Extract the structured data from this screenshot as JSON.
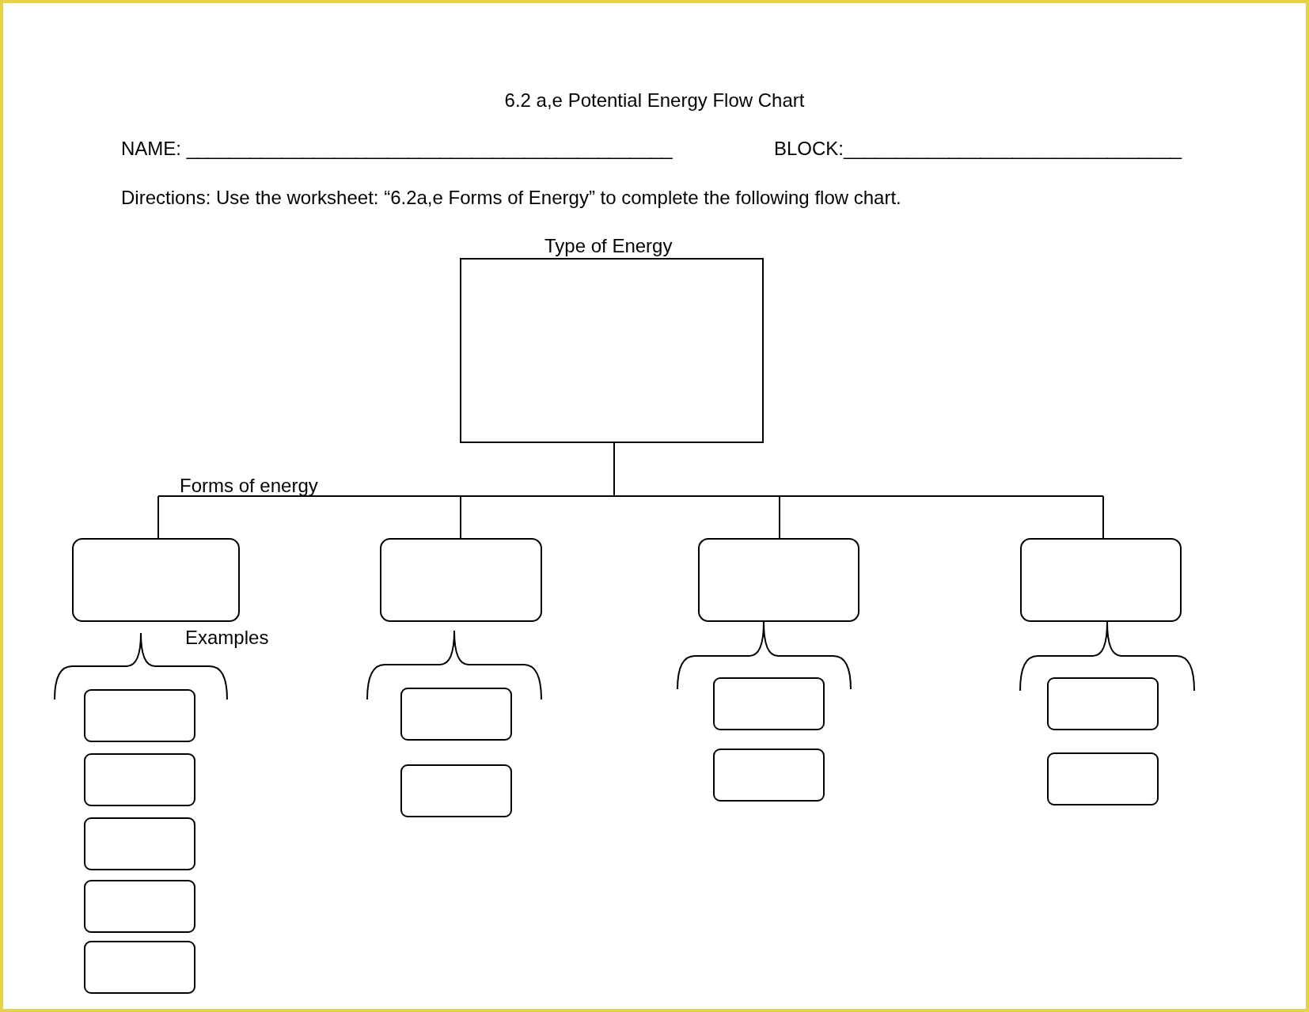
{
  "title": "6.2 a,e Potential Energy Flow Chart",
  "name_line": "NAME: ______________________________________________",
  "block_line": "BLOCK:________________________________",
  "directions": "Directions: Use the worksheet:  “6.2a,e Forms of Energy”  to complete the following flow chart.",
  "flow_chart": {
    "top_label": "Type of Energy",
    "branch_label": "Forms of energy",
    "examples_label": "Examples"
  }
}
